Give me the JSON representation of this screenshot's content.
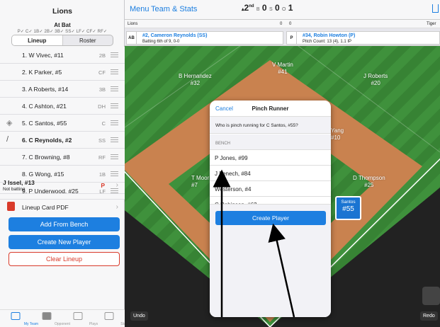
{
  "sidebar": {
    "team_name": "Lions",
    "at_bat_label": "At Bat",
    "position_checks": "P✓ C✓ 1B✓ 2B✓ 3B✓ SS✓ LF✓ CF✓ RF✓",
    "tabs": [
      "Lineup",
      "Roster"
    ],
    "lineup": [
      {
        "label": "1. W Vivec, #11",
        "pos": "2B",
        "icon": ""
      },
      {
        "label": "2. K Parker, #5",
        "pos": "CF",
        "icon": ""
      },
      {
        "label": "3. A Roberts, #14",
        "pos": "3B",
        "icon": ""
      },
      {
        "label": "4. C Ashton, #21",
        "pos": "DH",
        "icon": ""
      },
      {
        "label": "5. C Santos, #55",
        "pos": "C",
        "icon": "runner-icon"
      },
      {
        "label": "6. C Reynolds, #2",
        "pos": "SS",
        "icon": "bat-icon"
      },
      {
        "label": "7. C Browning, #8",
        "pos": "RF",
        "icon": ""
      },
      {
        "label": "8. G Wong, #15",
        "pos": "1B",
        "icon": ""
      },
      {
        "label": "9. P Underwood, #25",
        "pos": "LF",
        "icon": ""
      }
    ],
    "not_batting": {
      "name": "J Issel, #13",
      "status": "Not batting",
      "pos": "P"
    },
    "pdf_label": "Lineup Card PDF",
    "buttons": {
      "add_from_bench": "Add From Bench",
      "create_new_player": "Create New Player",
      "clear_lineup": "Clear Lineup"
    },
    "tabbar": [
      "My Team",
      "Opponent",
      "Plays",
      "Stats"
    ]
  },
  "topbar": {
    "menu": "Menu",
    "team_stats": "Team & Stats",
    "inning": "2",
    "inning_suffix": "nd",
    "balls_label": "B",
    "balls": "0",
    "strikes_label": "S",
    "strikes": "0",
    "outs_label": "O",
    "outs": "1"
  },
  "linescore": {
    "home_team": "Lions",
    "home_runs": "0",
    "away_runs": "0",
    "away_team": "Tiger"
  },
  "matchup": {
    "batter_tag": "AB",
    "batter_name": "#2, Cameron Reynolds (SS)",
    "batter_info": "Batting 6th of 9, 0-0",
    "pitcher_tag": "P",
    "pitcher_name": "#34, Robin Howton (P)",
    "pitcher_info": "Pitch Count: 13 (4), 1.1 IP"
  },
  "field": {
    "players": [
      {
        "name": "V Martin",
        "num": "#41"
      },
      {
        "name": "B Hernandez",
        "num": "#32"
      },
      {
        "name": "J Roberts",
        "num": "#20"
      },
      {
        "name": "Yang",
        "num": "#10"
      },
      {
        "name": "T Moor",
        "num": "#7"
      },
      {
        "name": "D Thompson",
        "num": "#25"
      }
    ],
    "runner_name": "Santos",
    "runner_num": "#55",
    "undo": "Undo",
    "redo": "Redo"
  },
  "modal": {
    "cancel": "Cancel",
    "title": "Pinch Runner",
    "question": "Who is pinch running for C Santos, #55?",
    "section": "BENCH",
    "bench": [
      "P Jones, #99",
      "J Fenech, #84",
      "Westerson, #4",
      "C Robinson, #62"
    ],
    "create_player": "Create Player"
  },
  "colors": {
    "accent": "#1d7fe0",
    "danger": "#d93b2b",
    "field_green": "#3c8b3a",
    "infield_dirt": "#c9824f"
  }
}
